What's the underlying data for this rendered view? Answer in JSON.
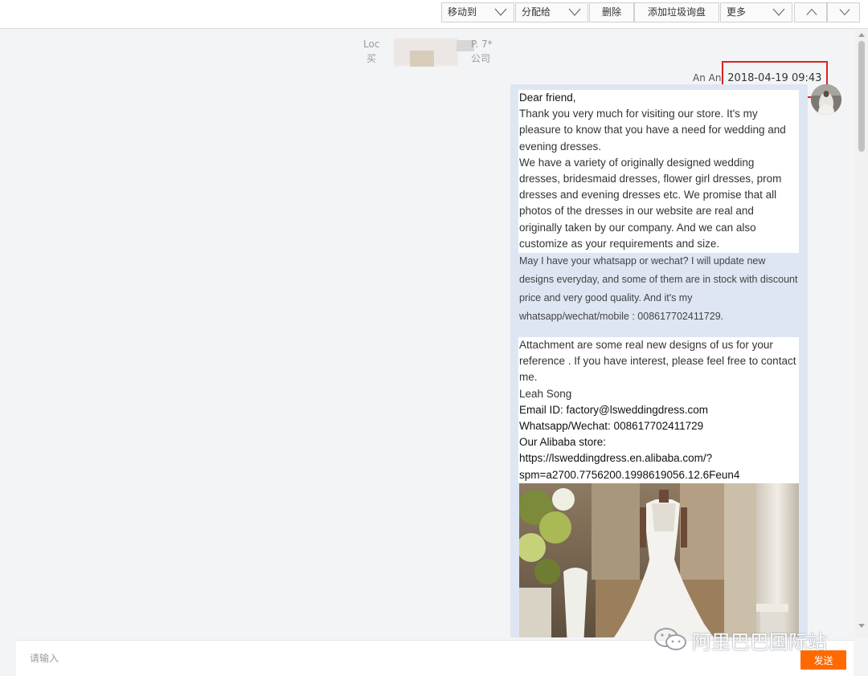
{
  "toolbar": {
    "move_to": "移动到",
    "assign_to": "分配给",
    "delete": "删除",
    "add_spam": "添加垃圾询盘",
    "more": "更多"
  },
  "sender": {
    "line1_prefix": "Loc",
    "line1_suffix": "P. 7*",
    "line2_prefix": "买",
    "line2_suffix": "公司"
  },
  "message": {
    "sender_name": "An An",
    "timestamp": "2018-04-19 09:43",
    "block1": [
      "Dear friend,",
      "Thank you very much for visiting our store. It's my pleasure to know that you have a need for wedding and evening dresses.",
      "We have a variety of originally designed wedding dresses, bridesmaid dresses, flower girl dresses, prom dresses and evening dresses etc. We promise that all photos of the dresses in our website are real and originally taken by our company. And we can also customize as your requirements and size."
    ],
    "block2": "May I have your whatsapp or wechat? I will update new designs everyday, and some of them are in stock with discount price and very good quality. And it's my whatsapp/wechat/mobile : 008617702411729.",
    "block3": {
      "attachment": "Attachment are some real new designs of us for your reference . If you have interest, please feel free to contact me.",
      "signature": "Leah Song",
      "email": "Email ID: factory@lsweddingdress.com",
      "whatsapp": "Whatsapp/Wechat: 008617702411729",
      "store_label": "Our Alibaba store:",
      "store_url_1": "https://lsweddingdress.en.alibaba.com/?",
      "store_url_2": "spm=a2700.7756200.1998619056.12.6Feun4"
    }
  },
  "input": {
    "placeholder": "请输入",
    "send_label": "发送"
  },
  "watermark": {
    "text": "阿里巴巴国际站"
  },
  "colors": {
    "accent_orange": "#ff6a00",
    "bubble_bg": "#dee6f3",
    "highlight_red": "#e02020"
  }
}
